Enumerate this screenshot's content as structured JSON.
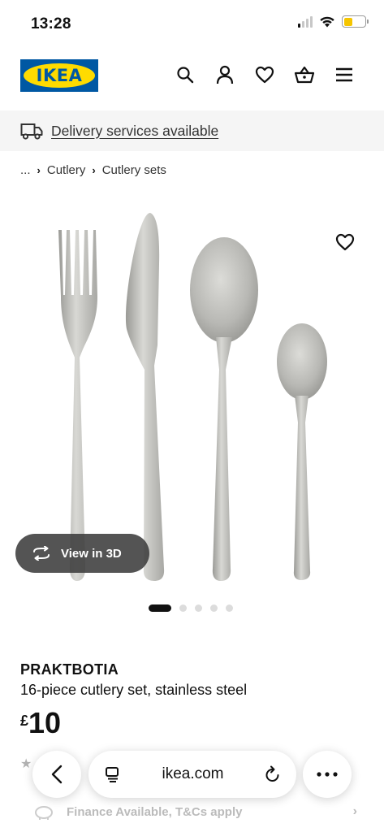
{
  "status_bar": {
    "time": "13:28"
  },
  "header": {
    "logo_text": "IKEA",
    "icons": [
      "search-icon",
      "profile-icon",
      "heart-icon",
      "basket-icon",
      "menu-icon"
    ]
  },
  "delivery": {
    "text": "Delivery services available",
    "icon": "truck-icon"
  },
  "breadcrumb": {
    "ellipsis": "...",
    "items": [
      "Cutlery",
      "Cutlery sets"
    ]
  },
  "gallery": {
    "view3d_label": "View in 3D",
    "dot_count": 5,
    "active_index": 0
  },
  "product": {
    "name": "PRAKTBOTIA",
    "description": "16-piece cutlery set, stainless steel",
    "currency": "£",
    "price": "10"
  },
  "finance": {
    "text": "Finance Available, T&Cs apply"
  },
  "browser": {
    "url": "ikea.com"
  },
  "colors": {
    "ikea_blue": "#0058a3",
    "ikea_yellow": "#ffdb00",
    "battery": "#f5c500",
    "banner_bg": "#f5f5f5"
  }
}
